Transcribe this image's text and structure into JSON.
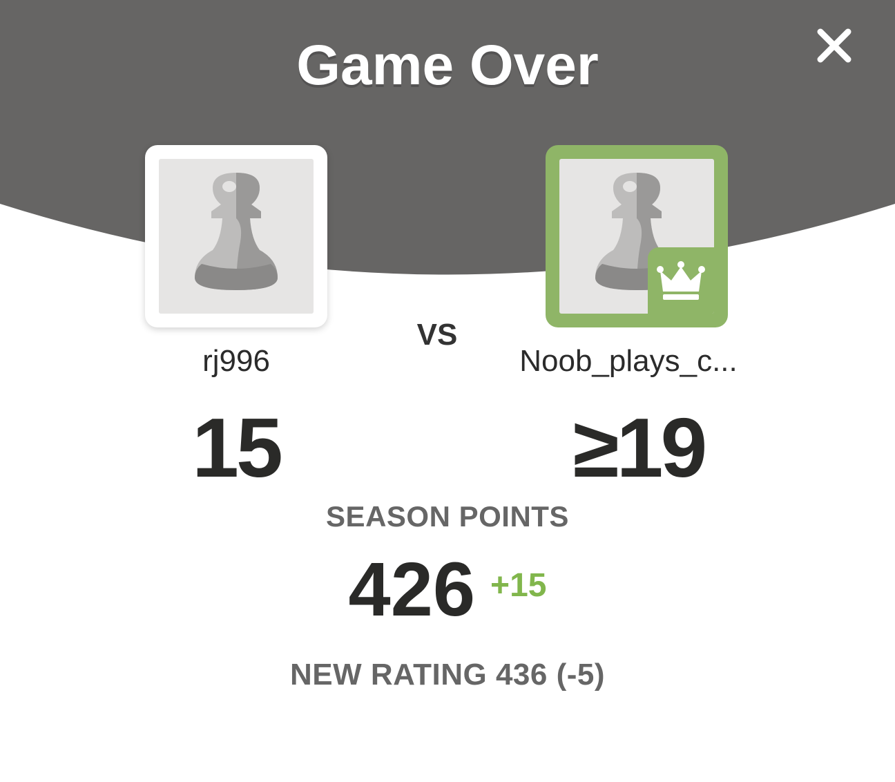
{
  "dialog": {
    "title": "Game Over",
    "close_icon": "close-icon"
  },
  "players": {
    "left": {
      "username": "rj996",
      "score": "15",
      "avatar_icon": "pawn-icon"
    },
    "right": {
      "username": "Noob_plays_c...",
      "score": "≥19",
      "avatar_icon": "pawn-icon",
      "winner_icon": "crown-icon"
    },
    "vs_label": "VS"
  },
  "season": {
    "label": "SEASON POINTS",
    "value": "426",
    "delta": "+15"
  },
  "rating": {
    "text": "NEW RATING 436 (-5)"
  },
  "colors": {
    "header": "#666564",
    "winner_green": "#8fb567",
    "delta_green": "#81b64c",
    "score_text": "#2a2a28",
    "muted_text": "#666666"
  }
}
